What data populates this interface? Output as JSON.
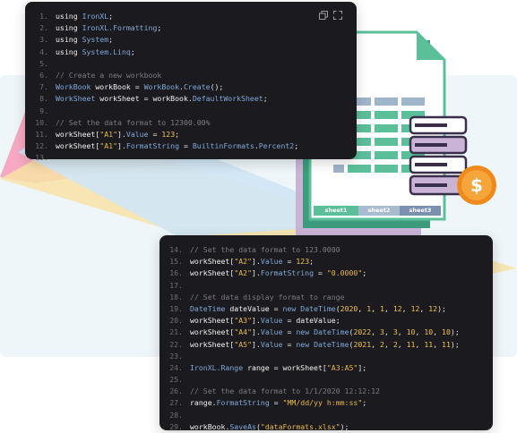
{
  "toolbar": {
    "copy_icon": "copy-icon",
    "expand_icon": "expand-icon"
  },
  "code_top": [
    {
      "n": "1.",
      "parts": [
        [
          "kw",
          "using "
        ],
        [
          "cls",
          "IronXL"
        ],
        [
          "punc",
          ";"
        ]
      ]
    },
    {
      "n": "2.",
      "parts": [
        [
          "kw",
          "using "
        ],
        [
          "cls",
          "IronXL.Formatting"
        ],
        [
          "punc",
          ";"
        ]
      ]
    },
    {
      "n": "3.",
      "parts": [
        [
          "kw",
          "using "
        ],
        [
          "cls",
          "System"
        ],
        [
          "punc",
          ";"
        ]
      ]
    },
    {
      "n": "4.",
      "parts": [
        [
          "kw",
          "using "
        ],
        [
          "cls",
          "System.Linq"
        ],
        [
          "punc",
          ";"
        ]
      ]
    },
    {
      "n": "5.",
      "parts": []
    },
    {
      "n": "6.",
      "parts": [
        [
          "cmt",
          "// Create a new workbook"
        ]
      ]
    },
    {
      "n": "7.",
      "parts": [
        [
          "cls",
          "WorkBook "
        ],
        [
          "ident",
          "workBook"
        ],
        [
          "punc",
          " = "
        ],
        [
          "cls",
          "WorkBook"
        ],
        [
          "punc",
          "."
        ],
        [
          "prop",
          "Create"
        ],
        [
          "punc",
          "();"
        ]
      ]
    },
    {
      "n": "8.",
      "parts": [
        [
          "cls",
          "WorkSheet "
        ],
        [
          "ident",
          "workSheet"
        ],
        [
          "punc",
          " = "
        ],
        [
          "ident",
          "workBook"
        ],
        [
          "punc",
          "."
        ],
        [
          "prop",
          "DefaultWorkSheet"
        ],
        [
          "punc",
          ";"
        ]
      ]
    },
    {
      "n": "9.",
      "parts": []
    },
    {
      "n": "10.",
      "parts": [
        [
          "cmt",
          "// Set the data format to 12300.00%"
        ]
      ]
    },
    {
      "n": "11.",
      "parts": [
        [
          "ident",
          "workSheet"
        ],
        [
          "punc",
          "["
        ],
        [
          "str",
          "\"A1\""
        ],
        [
          "punc",
          "]."
        ],
        [
          "prop",
          "Value"
        ],
        [
          "punc",
          " = "
        ],
        [
          "num",
          "123"
        ],
        [
          "punc",
          ";"
        ]
      ]
    },
    {
      "n": "12.",
      "parts": [
        [
          "ident",
          "workSheet"
        ],
        [
          "punc",
          "["
        ],
        [
          "str",
          "\"A1\""
        ],
        [
          "punc",
          "]."
        ],
        [
          "prop",
          "FormatString"
        ],
        [
          "punc",
          " = "
        ],
        [
          "cls",
          "BuiltinFormats"
        ],
        [
          "punc",
          "."
        ],
        [
          "prop",
          "Percent2"
        ],
        [
          "punc",
          ";"
        ]
      ]
    },
    {
      "n": "13.",
      "parts": []
    }
  ],
  "code_bottom": [
    {
      "n": "14.",
      "parts": [
        [
          "cmt",
          "// Set the data format to 123.0000"
        ]
      ]
    },
    {
      "n": "15.",
      "parts": [
        [
          "ident",
          "workSheet"
        ],
        [
          "punc",
          "["
        ],
        [
          "str",
          "\"A2\""
        ],
        [
          "punc",
          "]."
        ],
        [
          "prop",
          "Value"
        ],
        [
          "punc",
          " = "
        ],
        [
          "num",
          "123"
        ],
        [
          "punc",
          ";"
        ]
      ]
    },
    {
      "n": "16.",
      "parts": [
        [
          "ident",
          "workSheet"
        ],
        [
          "punc",
          "["
        ],
        [
          "str",
          "\"A2\""
        ],
        [
          "punc",
          "]."
        ],
        [
          "prop",
          "FormatString"
        ],
        [
          "punc",
          " = "
        ],
        [
          "str",
          "\"0.0000\""
        ],
        [
          "punc",
          ";"
        ]
      ]
    },
    {
      "n": "17.",
      "parts": []
    },
    {
      "n": "18.",
      "parts": [
        [
          "cmt",
          "// Set data display format to range"
        ]
      ]
    },
    {
      "n": "19.",
      "parts": [
        [
          "cls",
          "DateTime "
        ],
        [
          "ident",
          "dateValue"
        ],
        [
          "punc",
          " = "
        ],
        [
          "newk",
          "new "
        ],
        [
          "cls",
          "DateTime"
        ],
        [
          "punc",
          "("
        ],
        [
          "num",
          "2020"
        ],
        [
          "punc",
          ", "
        ],
        [
          "num",
          "1"
        ],
        [
          "punc",
          ", "
        ],
        [
          "num",
          "1"
        ],
        [
          "punc",
          ", "
        ],
        [
          "num",
          "12"
        ],
        [
          "punc",
          ", "
        ],
        [
          "num",
          "12"
        ],
        [
          "punc",
          ", "
        ],
        [
          "num",
          "12"
        ],
        [
          "punc",
          ");"
        ]
      ]
    },
    {
      "n": "20.",
      "parts": [
        [
          "ident",
          "workSheet"
        ],
        [
          "punc",
          "["
        ],
        [
          "str",
          "\"A3\""
        ],
        [
          "punc",
          "]."
        ],
        [
          "prop",
          "Value"
        ],
        [
          "punc",
          " = "
        ],
        [
          "ident",
          "dateValue"
        ],
        [
          "punc",
          ";"
        ]
      ]
    },
    {
      "n": "21.",
      "parts": [
        [
          "ident",
          "workSheet"
        ],
        [
          "punc",
          "["
        ],
        [
          "str",
          "\"A4\""
        ],
        [
          "punc",
          "]."
        ],
        [
          "prop",
          "Value"
        ],
        [
          "punc",
          " = "
        ],
        [
          "newk",
          "new "
        ],
        [
          "cls",
          "DateTime"
        ],
        [
          "punc",
          "("
        ],
        [
          "num",
          "2022"
        ],
        [
          "punc",
          ", "
        ],
        [
          "num",
          "3"
        ],
        [
          "punc",
          ", "
        ],
        [
          "num",
          "3"
        ],
        [
          "punc",
          ", "
        ],
        [
          "num",
          "10"
        ],
        [
          "punc",
          ", "
        ],
        [
          "num",
          "10"
        ],
        [
          "punc",
          ", "
        ],
        [
          "num",
          "10"
        ],
        [
          "punc",
          ");"
        ]
      ]
    },
    {
      "n": "22.",
      "parts": [
        [
          "ident",
          "workSheet"
        ],
        [
          "punc",
          "["
        ],
        [
          "str",
          "\"A5\""
        ],
        [
          "punc",
          "]."
        ],
        [
          "prop",
          "Value"
        ],
        [
          "punc",
          " = "
        ],
        [
          "newk",
          "new "
        ],
        [
          "cls",
          "DateTime"
        ],
        [
          "punc",
          "("
        ],
        [
          "num",
          "2021"
        ],
        [
          "punc",
          ", "
        ],
        [
          "num",
          "2"
        ],
        [
          "punc",
          ", "
        ],
        [
          "num",
          "2"
        ],
        [
          "punc",
          ", "
        ],
        [
          "num",
          "11"
        ],
        [
          "punc",
          ", "
        ],
        [
          "num",
          "11"
        ],
        [
          "punc",
          ", "
        ],
        [
          "num",
          "11"
        ],
        [
          "punc",
          ");"
        ]
      ]
    },
    {
      "n": "23.",
      "parts": []
    },
    {
      "n": "24.",
      "parts": [
        [
          "cls",
          "IronXL.Range "
        ],
        [
          "ident",
          "range"
        ],
        [
          "punc",
          " = "
        ],
        [
          "ident",
          "workSheet"
        ],
        [
          "punc",
          "["
        ],
        [
          "str",
          "\"A3:A5\""
        ],
        [
          "punc",
          "];"
        ]
      ]
    },
    {
      "n": "25.",
      "parts": []
    },
    {
      "n": "26.",
      "parts": [
        [
          "cmt",
          "// Set the data format to 1/1/2020 12:12:12"
        ]
      ]
    },
    {
      "n": "27.",
      "parts": [
        [
          "ident",
          "range"
        ],
        [
          "punc",
          "."
        ],
        [
          "prop",
          "FormatString"
        ],
        [
          "punc",
          " = "
        ],
        [
          "str",
          "\"MM/dd/yy h:mm:ss\""
        ],
        [
          "punc",
          ";"
        ]
      ]
    },
    {
      "n": "28.",
      "parts": []
    },
    {
      "n": "29.",
      "parts": [
        [
          "ident",
          "workBook"
        ],
        [
          "punc",
          "."
        ],
        [
          "prop",
          "SaveAs"
        ],
        [
          "punc",
          "("
        ],
        [
          "str",
          "\"dataFormats.xlsx\""
        ],
        [
          "punc",
          ");"
        ]
      ]
    }
  ],
  "sheets": {
    "tab1": "sheet1",
    "tab2": "sheet2",
    "tab3": "sheet3"
  },
  "illustration": {
    "file_icon": "spreadsheet-file-icon",
    "database_icon": "database-icon",
    "coin_icon": "dollar-coin-icon",
    "coin_symbol": "$"
  },
  "colors": {
    "panel": "#1b1b1f",
    "teal": "#5bbf9a",
    "purple": "#c9b4d6",
    "coin": "#f08a1c"
  }
}
